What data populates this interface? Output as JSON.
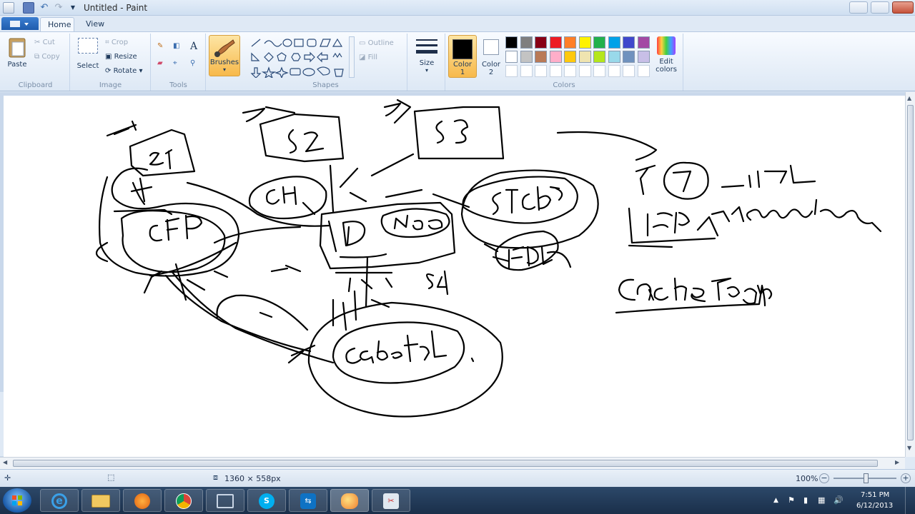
{
  "window": {
    "title": "Untitled - Paint"
  },
  "tabs": [
    {
      "label": "Home"
    },
    {
      "label": "View"
    }
  ],
  "clipboard": {
    "paste": "Paste",
    "cut": "Cut",
    "copy": "Copy",
    "group": "Clipboard"
  },
  "image": {
    "select": "Select",
    "crop": "Crop",
    "resize": "Resize",
    "rotate": "Rotate",
    "group": "Image"
  },
  "tools": {
    "group": "Tools",
    "brushes": "Brushes"
  },
  "shapes": {
    "outline": "Outline",
    "fill": "Fill",
    "group": "Shapes"
  },
  "size": {
    "label": "Size"
  },
  "colors": {
    "color1": "Color 1",
    "color2": "Color 2",
    "edit": "Edit colors",
    "group": "Colors",
    "color1_value": "#000000",
    "color2_value": "#ffffff",
    "palette": [
      "#000000",
      "#7f7f7f",
      "#880015",
      "#ed1c24",
      "#ff7f27",
      "#fff200",
      "#22b14c",
      "#00a2e8",
      "#3f48cc",
      "#a349a4",
      "#ffffff",
      "#c3c3c3",
      "#b97a57",
      "#ffaec9",
      "#ffc90e",
      "#efe4b0",
      "#b5e61d",
      "#99d9ea",
      "#7092be",
      "#c8bfe7"
    ]
  },
  "status": {
    "dimensions": "1360 × 558px",
    "zoom": "100%"
  },
  "tray": {
    "time": "7:51 PM",
    "date": "6/12/2013"
  }
}
